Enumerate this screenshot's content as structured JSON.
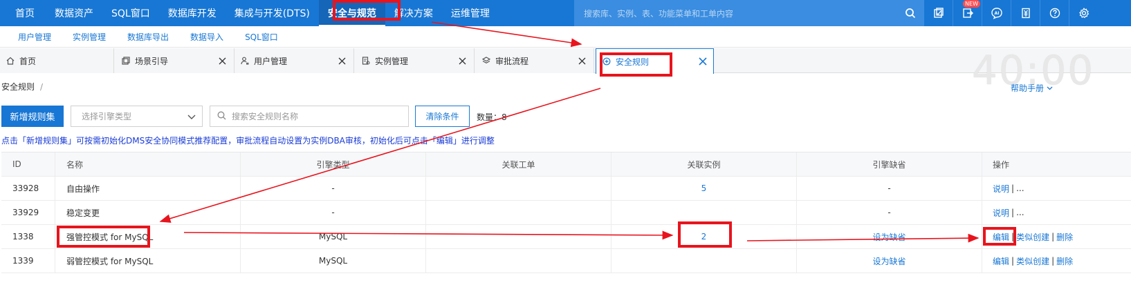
{
  "topnav": {
    "items": [
      "首页",
      "数据资产",
      "SQL窗口",
      "数据库开发",
      "集成与开发(DTS)",
      "安全与规范",
      "解决方案",
      "运维管理"
    ],
    "active_index": 5,
    "search_placeholder": "搜索库、实例、表、功能菜单和工单内容",
    "new_badge": "NEW",
    "icons": [
      "search-icon",
      "console-icon",
      "export-icon",
      "ai-icon",
      "billing-icon",
      "help-circle-icon",
      "gear-icon"
    ]
  },
  "subnav": {
    "items": [
      "用户管理",
      "实例管理",
      "数据库导出",
      "数据导入",
      "SQL窗口"
    ]
  },
  "tabs": {
    "items": [
      {
        "label": "首页",
        "icon": "home-icon",
        "closable": false
      },
      {
        "label": "场景引导",
        "icon": "guide-icon",
        "closable": true
      },
      {
        "label": "用户管理",
        "icon": "user-icon",
        "closable": true
      },
      {
        "label": "实例管理",
        "icon": "instance-icon",
        "closable": true
      },
      {
        "label": "审批流程",
        "icon": "layers-icon",
        "closable": true
      },
      {
        "label": "安全规则",
        "icon": "shield-plus-icon",
        "closable": true
      }
    ],
    "active_index": 5,
    "watermark": "40:00"
  },
  "breadcrumb": {
    "current": "安全规则",
    "separator": "/"
  },
  "help": {
    "label": "帮助手册"
  },
  "toolbar": {
    "new_button": "新增规则集",
    "engine_select_placeholder": "选择引擎类型",
    "search_placeholder": "搜索安全规则名称",
    "clear_button": "清除条件",
    "count_label": "数量：8"
  },
  "notice": "点击「新增规则集」可按需初始化DMS安全协同模式推荐配置，审批流程自动设置为实例DBA审核，初始化后可点击「编辑」进行调整",
  "table": {
    "columns": [
      "ID",
      "名称",
      "引擎类型",
      "关联工单",
      "关联实例",
      "引擎缺省",
      "操作"
    ],
    "rows": [
      {
        "id": "33928",
        "name": "自由操作",
        "engine": "-",
        "ticket": "",
        "instances": "5",
        "default": "-",
        "ops": [
          "说明",
          "..."
        ]
      },
      {
        "id": "33929",
        "name": "稳定变更",
        "engine": "-",
        "ticket": "",
        "instances": "",
        "default": "-",
        "ops": [
          "说明",
          "..."
        ]
      },
      {
        "id": "1338",
        "name": "强管控模式 for MySQL",
        "engine": "MySQL",
        "ticket": "",
        "instances": "2",
        "default": "设为缺省",
        "ops": [
          "编辑",
          "类似创建",
          "删除"
        ]
      },
      {
        "id": "1339",
        "name": "弱管控模式 for MySQL",
        "engine": "MySQL",
        "ticket": "",
        "instances": "",
        "default": "设为缺省",
        "ops": [
          "编辑",
          "类似创建",
          "删除"
        ]
      }
    ]
  },
  "annotation_color": "#e8141d"
}
